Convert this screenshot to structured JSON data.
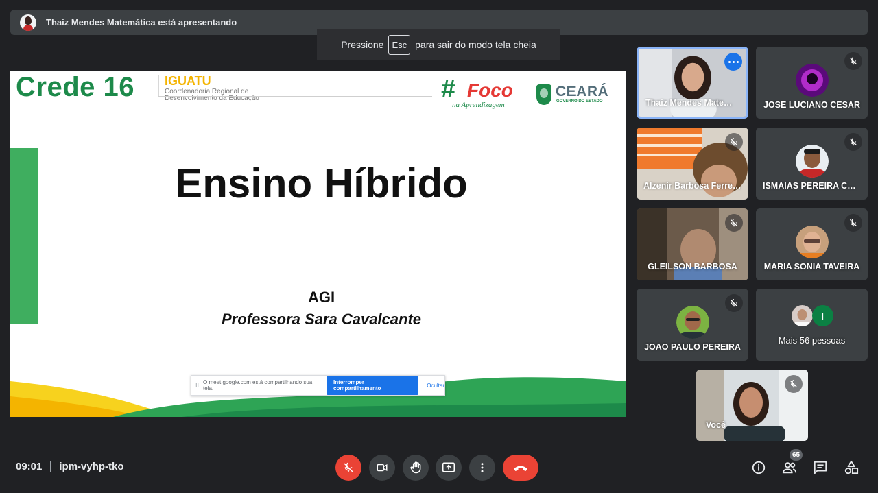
{
  "presenter_banner": {
    "text": "Thaiz Mendes Matemática está apresentando"
  },
  "fullscreen_toast": {
    "prefix": "Pressione",
    "key": "Esc",
    "suffix": "para sair do modo tela cheia"
  },
  "slide": {
    "logo_crede": "Crede 16",
    "logo_iguatu": "IGUATU",
    "logo_iguatu_sub": "Coordenadoria Regional de Desenvolvimento da Educação",
    "logo_foco_hash": "#",
    "logo_foco_word": "Foco",
    "logo_foco_sub": "na Aprendizagem",
    "logo_ceara": "CEARÁ",
    "logo_ceara_sub": "GOVERNO DO ESTADO",
    "title": "Ensino Híbrido",
    "agi": "AGI",
    "professor": "Professora Sara Cavalcante",
    "share_notice": {
      "handle": "II",
      "message": "O meet.google.com está compartilhando sua tela.",
      "stop_label": "Interromper compartilhamento",
      "hide_label": "Ocultar"
    }
  },
  "participants": [
    {
      "name": "Thaiz Mendes Matemática"
    },
    {
      "name": "JOSE LUCIANO CESAR"
    },
    {
      "name": "Alzenir Barbosa Ferreira"
    },
    {
      "name": "ISMAIAS PEREIRA COSTA"
    },
    {
      "name": "GLEILSON BARBOSA"
    },
    {
      "name": "MARIA SONIA TAVEIRA"
    },
    {
      "name": "JOAO PAULO PEREIRA"
    },
    {
      "name": "Mais 56 pessoas",
      "initial": "I"
    },
    {
      "name": "Você"
    }
  ],
  "footer": {
    "time": "09:01",
    "meeting_code": "ipm-vyhp-tko",
    "participant_count": "65"
  },
  "colors": {
    "active_speaker": "#8ab4f8",
    "danger": "#ea4335",
    "accent": "#1a73e8"
  }
}
